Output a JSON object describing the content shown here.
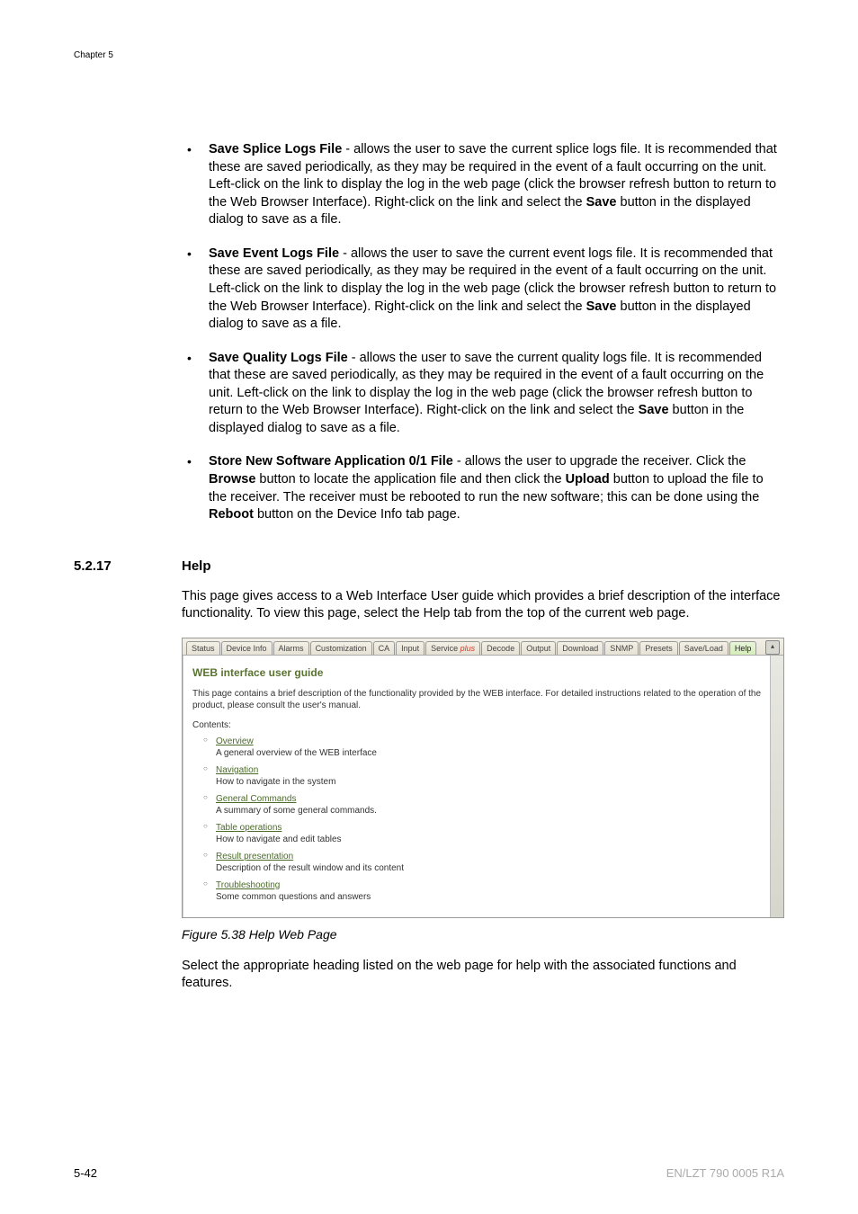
{
  "chapter_label": "Chapter 5",
  "bullets": [
    {
      "lead": "Save Splice Logs File",
      "rest": " - allows the user to save the current splice logs file. It is recommended that these are saved periodically, as they may be required in the event of a fault occurring on the unit. Left-click on the link to display the log in the web page (click the browser refresh button to return to the Web Browser Interface). Right-click on the link and select the ",
      "bold2": "Save",
      "rest2": " button in the displayed dialog to save as a file."
    },
    {
      "lead": "Save Event Logs File",
      "rest": " - allows the user to save the current event logs file. It is recommended that these are saved periodically, as they may be required in the event of a fault occurring on the unit. Left-click on the link to display the log in the web page (click the browser refresh button to return to the Web Browser Interface). Right-click on the link and select the ",
      "bold2": "Save",
      "rest2": " button in the displayed dialog to save as a file."
    },
    {
      "lead": "Save Quality Logs File",
      "rest": " - allows the user to save the current quality logs file. It is recommended that these are saved periodically, as they may be required in the event of a fault occurring on the unit. Left-click on the link to display the log in the web page (click the browser refresh button to return to the Web Browser Interface). Right-click on the link and select the ",
      "bold2": "Save",
      "rest2": " button in the displayed dialog to save as a file."
    },
    {
      "lead": "Store New Software Application 0/1 File",
      "rest": " - allows the user to upgrade the receiver. Click the ",
      "bold2": "Browse",
      "rest2": " button to locate the application file and then click the ",
      "bold3": "Upload",
      "rest3": " button to upload the file to the receiver. The receiver must be rebooted to run the new software; this can be done using the ",
      "bold4": "Reboot",
      "rest4": " button on the Device Info tab page."
    }
  ],
  "section": {
    "num": "5.2.17",
    "title": "Help"
  },
  "intro": "This page gives access to a Web Interface User guide which provides a brief description of the interface functionality. To view this page, select the Help tab from the top of the current web page.",
  "tabs": [
    "Status",
    "Device Info",
    "Alarms",
    "Customization",
    "CA",
    "Input",
    "Service plus",
    "Decode",
    "Output",
    "Download",
    "SNMP",
    "Presets",
    "Save/Load",
    "Help"
  ],
  "service_plus": {
    "base": "Service ",
    "plus": "plus"
  },
  "wg": {
    "title": "WEB interface user guide",
    "desc": "This page contains a brief description of the functionality provided by the WEB interface. For detailed instructions related to the operation of the product, please consult the user's manual.",
    "contents_label": "Contents:",
    "items": [
      {
        "link": "Overview",
        "desc": "A general overview of the WEB interface"
      },
      {
        "link": "Navigation",
        "desc": "How to navigate in the system"
      },
      {
        "link": "General Commands",
        "desc": "A summary of some general commands."
      },
      {
        "link": "Table operations",
        "desc": "How to navigate and edit tables"
      },
      {
        "link": "Result presentation",
        "desc": "Description of the result window and its content"
      },
      {
        "link": "Troubleshooting",
        "desc": "Some common questions and answers"
      }
    ]
  },
  "figure_caption": "Figure 5.38 Help Web Page",
  "closing": "Select the appropriate heading listed on the web page for help with the associated functions and features.",
  "footer": {
    "left": "5-42",
    "right": "EN/LZT 790 0005 R1A"
  }
}
